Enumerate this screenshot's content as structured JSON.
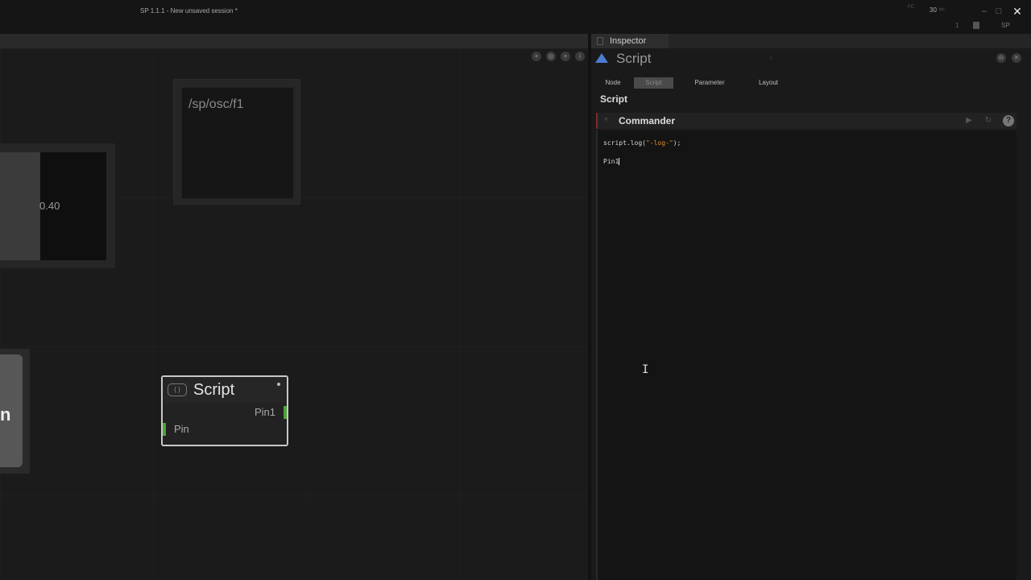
{
  "titlebar": {
    "title": "SP 1.1.1 - New unsaved session *",
    "fps_label": "FC",
    "fps_value": "30",
    "fps_unit": "fps",
    "status_count": "1",
    "logo": "SP",
    "minimize_icon": "minimize-icon",
    "maximize_icon": "maximize-icon",
    "close_icon": "close-icon"
  },
  "canvas": {
    "osc_node": {
      "label": "/sp/osc/f1"
    },
    "slider_node": {
      "value": "0.40"
    },
    "left_node": {
      "partial_label": "n"
    },
    "script_node": {
      "title": "Script",
      "output_pin": "Pin1",
      "input_pin": "Pin"
    }
  },
  "inspector": {
    "tab_label": "Inspector",
    "title": "Script",
    "subtabs": [
      "Node",
      "Script",
      "Parameter",
      "Layout"
    ],
    "active_subtab": "Script",
    "section_label": "Script",
    "commander": {
      "label": "Commander",
      "code_line1_prefix": "script.log(",
      "code_line1_string": "\"-log-\"",
      "code_line1_suffix": ");",
      "code_line2": "Pin1"
    }
  },
  "colors": {
    "accent_pin": "#4ea33a",
    "code_string": "#d98c2a",
    "script_icon": "#4c7bd1",
    "commander_marker": "#7b2b2b"
  }
}
